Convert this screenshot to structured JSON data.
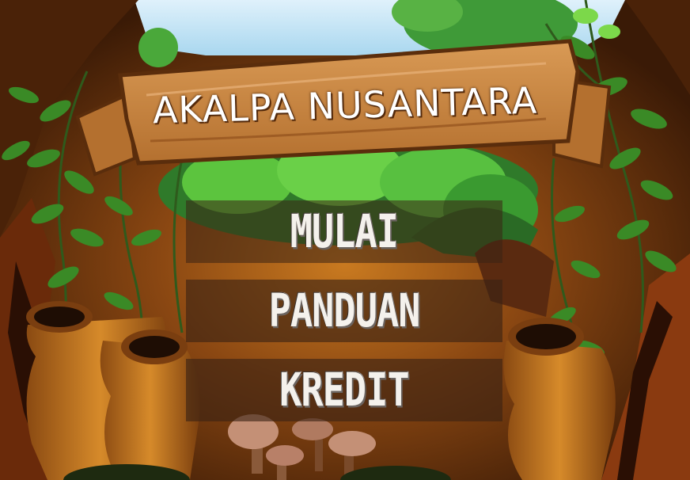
{
  "game": {
    "title": "AKALPA NUSANTARA"
  },
  "menu": {
    "items": [
      {
        "label": "MULAI"
      },
      {
        "label": "PANDUAN"
      },
      {
        "label": "KREDIT"
      }
    ]
  },
  "colors": {
    "background_dark": "#3a1c08",
    "wood_sign": "#c98a45",
    "leaf_green": "#4aa83a",
    "button_overlay": "#3a2214",
    "label_text": "#f4f1ec"
  }
}
